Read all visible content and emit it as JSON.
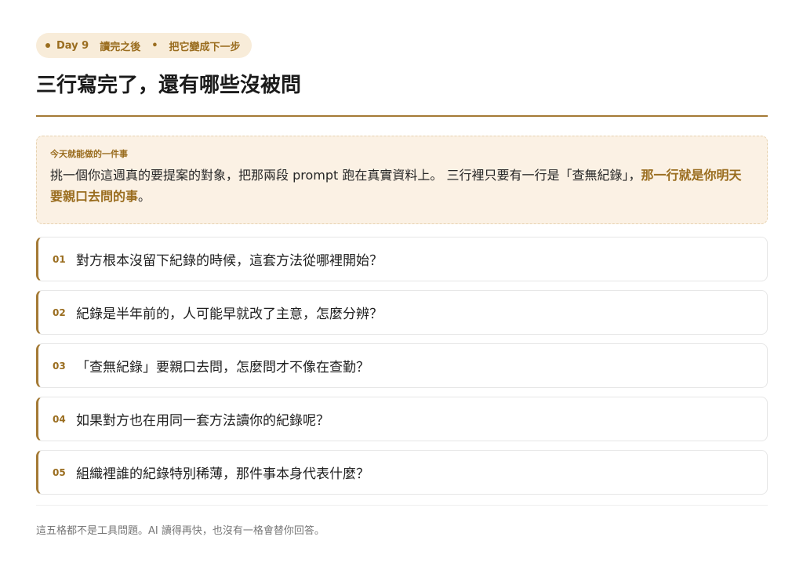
{
  "badge": {
    "day": "Day 9",
    "part1": "讀完之後",
    "separator": "•",
    "part2": "把它變成下一步"
  },
  "title": "三行寫完了，還有哪些沒被問",
  "today": {
    "label": "今天就能做的一件事",
    "body_plain": "挑一個你這週真的要提案的對象，把那兩段 prompt 跑在真實資料上。 三行裡只要有一行是「查無紀錄」，",
    "body_highlight": "那一行就是你明天要親口去問的事",
    "body_end": "。"
  },
  "questions": [
    {
      "num": "01",
      "text": "對方根本沒留下紀錄的時候，這套方法從哪裡開始？"
    },
    {
      "num": "02",
      "text": "紀錄是半年前的，人可能早就改了主意，怎麼分辨？"
    },
    {
      "num": "03",
      "text": "「查無紀錄」要親口去問，怎麼問才不像在查勤？"
    },
    {
      "num": "04",
      "text": "如果對方也在用同一套方法讀你的紀錄呢？"
    },
    {
      "num": "05",
      "text": "組織裡誰的紀錄特別稀薄，那件事本身代表什麼？"
    }
  ],
  "footer": "這五格都不是工具問題。AI 讀得再快，也沒有一格會替你回答。",
  "colors": {
    "accent": "#9a6d1f",
    "badge_bg": "#f8ecd9",
    "callout_bg": "#fbf1e4"
  }
}
